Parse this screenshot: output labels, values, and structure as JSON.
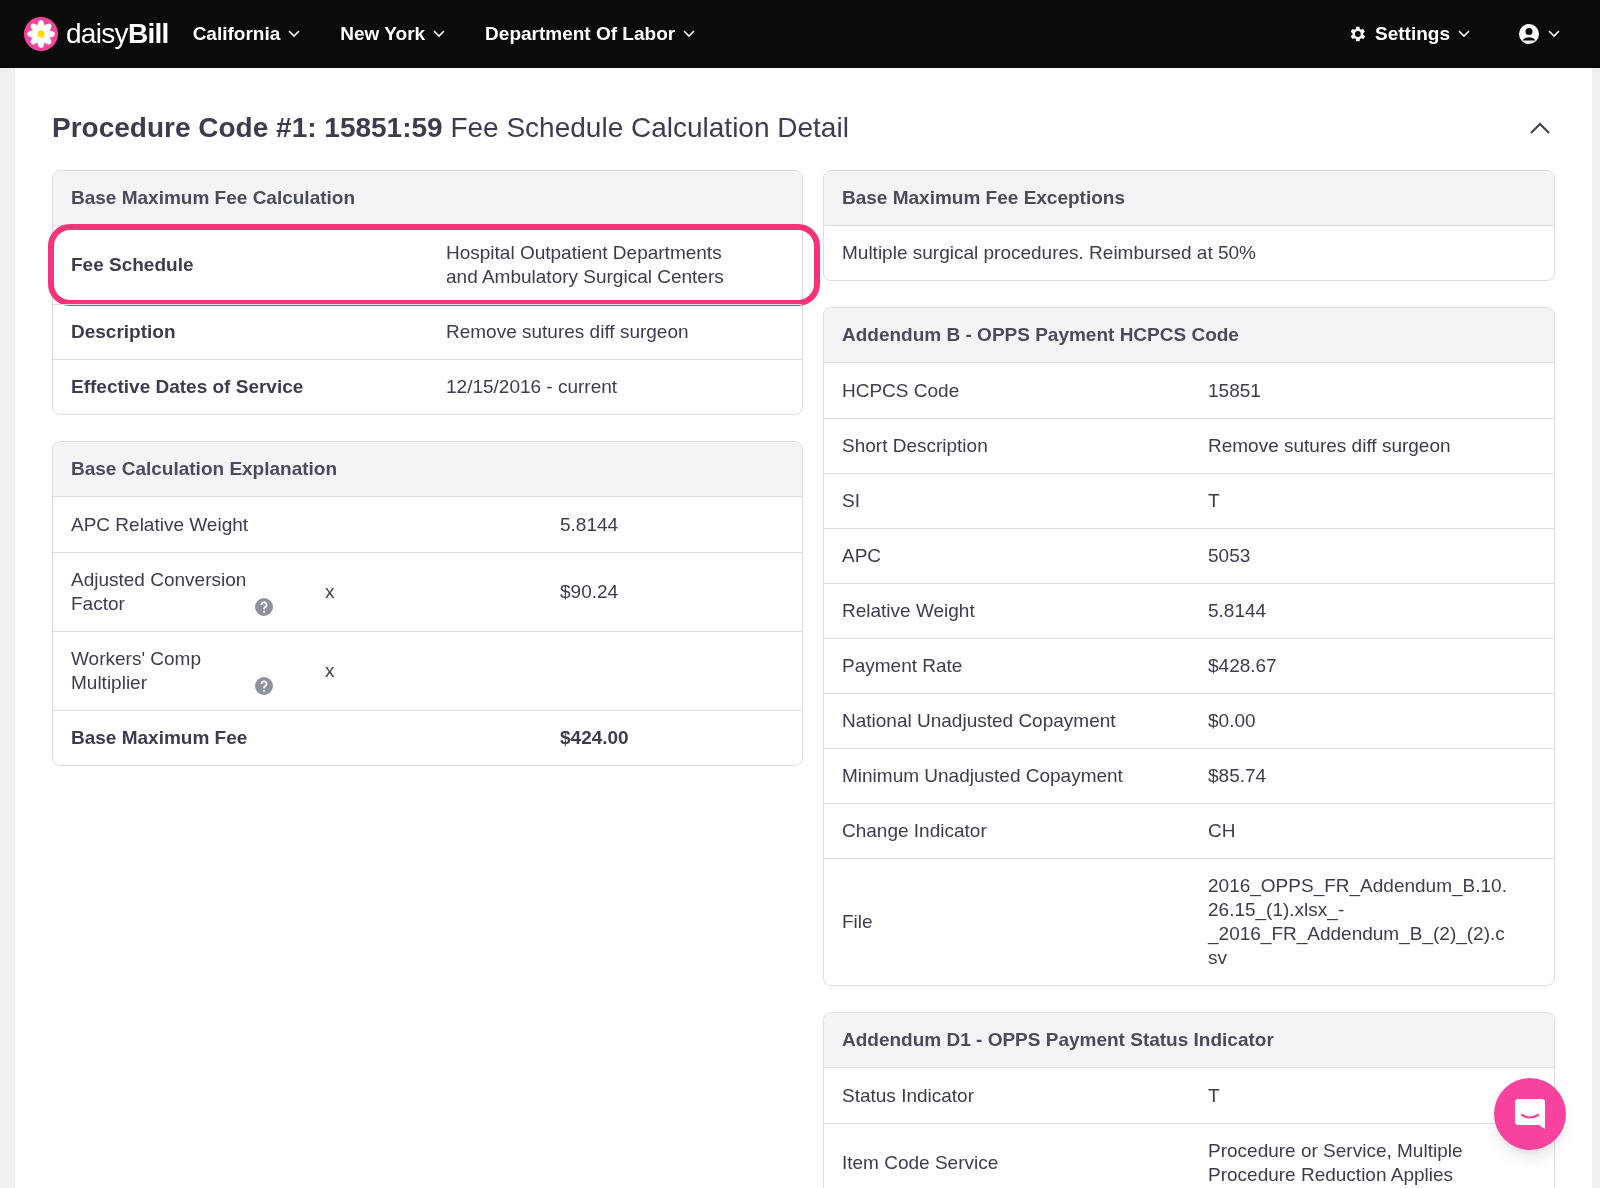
{
  "navbar": {
    "logo": {
      "prefix": "daisy",
      "suffix": "Bill"
    },
    "menus": [
      {
        "label": "California"
      },
      {
        "label": "New York"
      },
      {
        "label": "Department Of Labor"
      }
    ],
    "settings": {
      "label": "Settings"
    }
  },
  "page": {
    "title_bold": "Procedure Code #1: 15851:59",
    "title_rest": "Fee Schedule Calculation Detail",
    "expanded": true
  },
  "left_cards": [
    {
      "title": "Base Maximum Fee Calculation",
      "kind": "pairs",
      "bold_labels": true,
      "rows": [
        {
          "label": "Fee Schedule",
          "value": "Hospital Outpatient Departments and Ambulatory Surgical Centers",
          "highlighted": true
        },
        {
          "label": "Description",
          "value": "Remove sutures diff surgeon",
          "highlighted": false
        },
        {
          "label": "Effective Dates of Service",
          "value": "12/15/2016 - current",
          "highlighted": false
        }
      ]
    },
    {
      "title": "Base Calculation Explanation",
      "kind": "calc",
      "rows": [
        {
          "label": "APC Relative Weight",
          "operator": "",
          "value": "5.8144",
          "help": false,
          "total": false
        },
        {
          "label": "Adjusted Conversion Factor",
          "operator": "x",
          "value": "$90.24",
          "help": true,
          "total": false
        },
        {
          "label": "Workers' Comp Multiplier",
          "operator": "x",
          "value": "",
          "help": true,
          "total": false
        },
        {
          "label": "Base Maximum Fee",
          "operator": "",
          "value": "$424.00",
          "help": false,
          "total": true
        }
      ]
    }
  ],
  "right_cards": [
    {
      "title": "Base Maximum Fee Exceptions",
      "kind": "note",
      "text": "Multiple surgical procedures. Reimbursed at 50%"
    },
    {
      "title": "Addendum B - OPPS Payment HCPCS Code",
      "kind": "pairs",
      "bold_labels": false,
      "rows": [
        {
          "label": "HCPCS Code",
          "value": "15851"
        },
        {
          "label": "Short Description",
          "value": "Remove sutures diff surgeon"
        },
        {
          "label": "SI",
          "value": "T"
        },
        {
          "label": "APC",
          "value": "5053"
        },
        {
          "label": "Relative Weight",
          "value": "5.8144"
        },
        {
          "label": "Payment Rate",
          "value": "$428.67"
        },
        {
          "label": "National Unadjusted Copayment",
          "value": "$0.00"
        },
        {
          "label": "Minimum Unadjusted Copayment",
          "value": "$85.74"
        },
        {
          "label": "Change Indicator",
          "value": "CH"
        },
        {
          "label": "File",
          "value": "2016_OPPS_FR_Addendum_B.10.26.15_(1).xlsx_-_2016_FR_Addendum_B_(2)_(2).csv"
        }
      ]
    },
    {
      "title": "Addendum D1 - OPPS Payment Status Indicator",
      "kind": "pairs",
      "bold_labels": false,
      "rows": [
        {
          "label": "Status Indicator",
          "value": "T"
        },
        {
          "label": "Item Code Service",
          "value": "Procedure or Service, Multiple Procedure Reduction Applies"
        }
      ]
    }
  ]
}
